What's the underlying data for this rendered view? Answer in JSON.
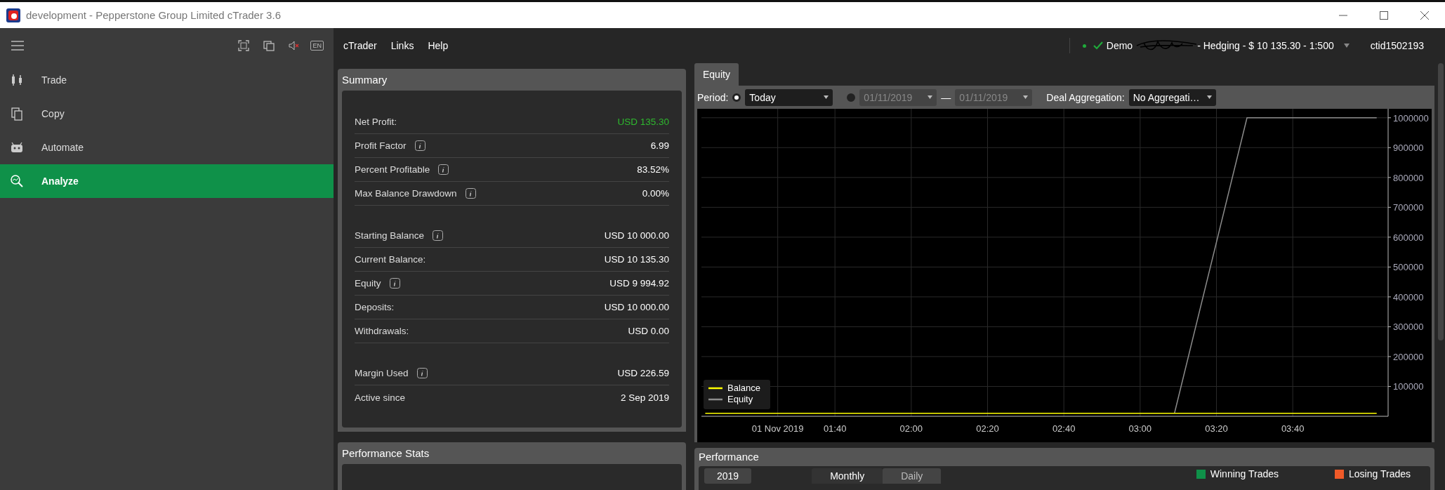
{
  "window": {
    "title": "development - Pepperstone Group Limited cTrader 3.6"
  },
  "sidebar": {
    "language": "EN",
    "muted": true,
    "items": [
      {
        "kind": "trade",
        "label": "Trade",
        "selected": false
      },
      {
        "kind": "copy",
        "label": "Copy",
        "selected": false
      },
      {
        "kind": "automate",
        "label": "Automate",
        "selected": false
      },
      {
        "kind": "analyze",
        "label": "Analyze",
        "selected": true
      }
    ]
  },
  "menu": [
    "cTrader",
    "Links",
    "Help"
  ],
  "account": {
    "connected": true,
    "mode": "Demo",
    "details": "- Hedging - $ 10 135.30 - 1:500",
    "user": "ctid1502193"
  },
  "summary": {
    "title": "Summary",
    "groups": [
      [
        {
          "label": "Net Profit:",
          "info": false,
          "positive": true,
          "value": "USD 135.30"
        },
        {
          "label": "Profit Factor",
          "info": true,
          "positive": false,
          "value": "6.99"
        },
        {
          "label": "Percent Profitable",
          "info": true,
          "positive": false,
          "value": "83.52%"
        },
        {
          "label": "Max Balance Drawdown",
          "info": true,
          "positive": false,
          "value": "0.00%"
        }
      ],
      [
        {
          "label": "Starting Balance",
          "info": true,
          "positive": false,
          "value": "USD 10 000.00"
        },
        {
          "label": "Current Balance:",
          "info": false,
          "positive": false,
          "value": "USD 10 135.30"
        },
        {
          "label": "Equity",
          "info": true,
          "positive": false,
          "value": "USD 9 994.92"
        },
        {
          "label": "Deposits:",
          "info": false,
          "positive": false,
          "value": "USD 10 000.00"
        },
        {
          "label": "Withdrawals:",
          "info": false,
          "positive": false,
          "value": "USD 0.00"
        }
      ],
      [
        {
          "label": "Margin Used",
          "info": true,
          "positive": false,
          "value": "USD 226.59"
        },
        {
          "label": "Active since",
          "info": false,
          "positive": false,
          "value": "2 Sep 2019"
        }
      ]
    ]
  },
  "performance_stats": {
    "title": "Performance Stats"
  },
  "equity": {
    "tabs": [
      {
        "label": "Equity",
        "selected": true
      }
    ],
    "period_label": "Period:",
    "preset": {
      "selected": true,
      "value": "Today"
    },
    "range": {
      "selected": false,
      "from": "01/11/2019",
      "separator": "—",
      "to": "01/11/2019"
    },
    "aggregation_label": "Deal Aggregation:",
    "aggregation": "No Aggregati…",
    "chart_data": {
      "type": "line",
      "x": [
        66,
        189,
        208,
        242
      ],
      "grid": true,
      "legend": true,
      "series": [
        {
          "name": "Balance",
          "color": "#ffff00",
          "values": [
            10000,
            10000,
            10000,
            10000
          ]
        },
        {
          "name": "Equity",
          "color": "#8c8c8c",
          "values": [
            null,
            10000,
            1000000,
            1000000
          ]
        }
      ],
      "xlim": [
        65,
        245
      ],
      "ylim": [
        0,
        1030000
      ],
      "xticks": [
        {
          "value": 85,
          "label": "01 Nov 2019"
        },
        {
          "value": 100,
          "label": "01:40"
        },
        {
          "value": 120,
          "label": "02:00"
        },
        {
          "value": 140,
          "label": "02:20"
        },
        {
          "value": 160,
          "label": "02:40"
        },
        {
          "value": 180,
          "label": "03:00"
        },
        {
          "value": 200,
          "label": "03:20"
        },
        {
          "value": 220,
          "label": "03:40"
        }
      ],
      "yticks": [
        100000,
        200000,
        300000,
        400000,
        500000,
        600000,
        700000,
        800000,
        900000,
        1000000
      ]
    }
  },
  "performance": {
    "title": "Performance",
    "year": "2019",
    "tabs": [
      {
        "label": "Monthly",
        "selected": true
      },
      {
        "label": "Daily",
        "selected": false
      }
    ],
    "legend": [
      {
        "label": "Winning Trades",
        "color": "#0f9149"
      },
      {
        "label": "Losing Trades",
        "color": "#f05a28"
      }
    ]
  }
}
